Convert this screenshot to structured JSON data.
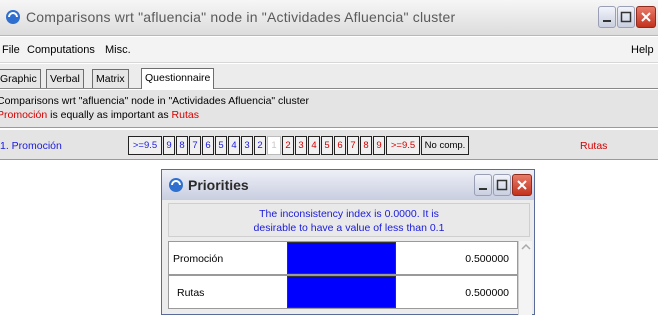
{
  "window": {
    "title": "Comparisons wrt \"afluencia\" node in \"Actividades Afluencia\" cluster",
    "icon": "app-logo-icon"
  },
  "menu": {
    "items": [
      "File",
      "Computations",
      "Misc."
    ],
    "help": "Help"
  },
  "tabs": [
    {
      "label": "Graphic",
      "active": false
    },
    {
      "label": "Verbal",
      "active": false
    },
    {
      "label": "Matrix",
      "active": false
    },
    {
      "label": "Questionnaire",
      "active": true
    }
  ],
  "info": {
    "line1": "Comparisons wrt \"afluencia\" node in \"Actividades Afluencia\" cluster",
    "left_item": "Promoción",
    "middle": " is equally as important as ",
    "right_item": "Rutas"
  },
  "comparison": {
    "left_label": "1. Promoción",
    "scale": [
      {
        "label": ">=9.5",
        "side": "left"
      },
      {
        "label": "9",
        "side": "left"
      },
      {
        "label": "8",
        "side": "left"
      },
      {
        "label": "7",
        "side": "left"
      },
      {
        "label": "6",
        "side": "left"
      },
      {
        "label": "5",
        "side": "left"
      },
      {
        "label": "4",
        "side": "left"
      },
      {
        "label": "3",
        "side": "left"
      },
      {
        "label": "2",
        "side": "left"
      },
      {
        "label": "1",
        "side": "selected"
      },
      {
        "label": "2",
        "side": "right"
      },
      {
        "label": "3",
        "side": "right"
      },
      {
        "label": "4",
        "side": "right"
      },
      {
        "label": "5",
        "side": "right"
      },
      {
        "label": "6",
        "side": "right"
      },
      {
        "label": "7",
        "side": "right"
      },
      {
        "label": "8",
        "side": "right"
      },
      {
        "label": "9",
        "side": "right"
      },
      {
        "label": ">=9.5",
        "side": "right"
      },
      {
        "label": "No comp.",
        "side": "none"
      }
    ],
    "right_label": "Rutas"
  },
  "priorities": {
    "title": "Priorities",
    "note_line1": "The inconsistency index is 0.0000.  It is",
    "note_line2": "desirable to have a value of less than 0.1",
    "rows": [
      {
        "label": "Promoción",
        "value": "0.500000"
      },
      {
        "label": "Rutas",
        "value": "0.500000"
      }
    ],
    "bar_color": "#0000ff"
  },
  "colors": {
    "left_side": "#1a1adc",
    "right_side": "#d40000"
  }
}
